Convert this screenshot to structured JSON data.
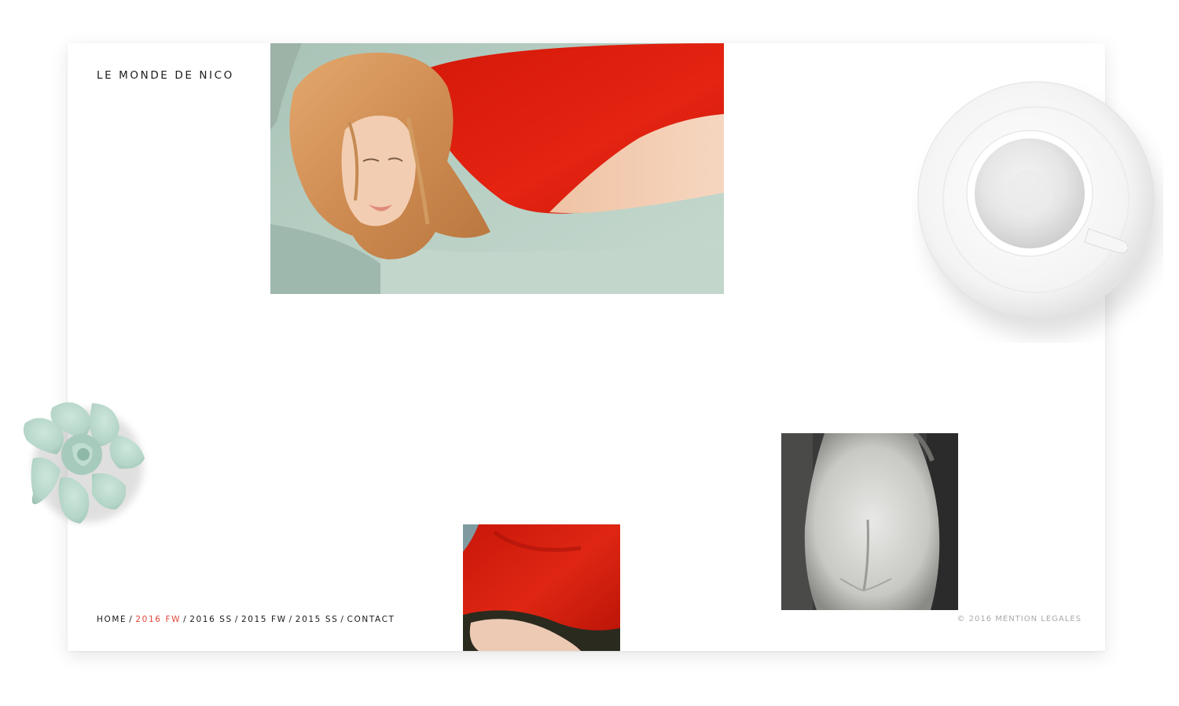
{
  "site": {
    "title": "LE MONDE DE NICO"
  },
  "nav": {
    "items": [
      {
        "label": "HOME",
        "active": false
      },
      {
        "label": "2016 FW",
        "active": true
      },
      {
        "label": "2016 SS",
        "active": false
      },
      {
        "label": "2015 FW",
        "active": false
      },
      {
        "label": "2015 SS",
        "active": false
      },
      {
        "label": "CONTACT",
        "active": false
      }
    ],
    "separator": "/",
    "active_color": "#e2473c"
  },
  "footer": {
    "legal": "© 2016 MENTION LEGALES"
  },
  "gallery": [
    {
      "name": "photo-woman-red-dress"
    },
    {
      "name": "photo-red-dress-detail"
    },
    {
      "name": "photo-statue"
    }
  ],
  "decor": {
    "cup": "coffee-cup-on-saucer",
    "flower": "mint-flower"
  },
  "colors": {
    "accent": "#e2473c",
    "text": "#1a1a1a",
    "muted": "#aaaaaa",
    "mint": "#b9d9cc",
    "dress_red": "#e01a0c"
  }
}
